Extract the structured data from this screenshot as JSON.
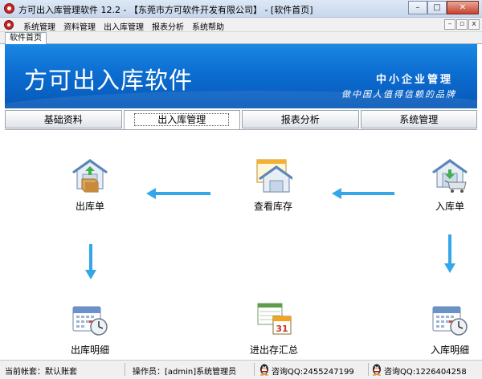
{
  "window": {
    "title": "方可出入库管理软件 12.2 - 【东莞市方可软件开发有限公司】 - [软件首页]",
    "buttons": {
      "minimize": "–",
      "maximize": "□",
      "close": "✕"
    }
  },
  "menu": {
    "items": [
      "系统管理",
      "资料管理",
      "出入库管理",
      "报表分析",
      "系统帮助"
    ],
    "mdi_buttons": {
      "minimize": "–",
      "restore": "▫",
      "close": "x"
    }
  },
  "doc_tab": {
    "label": "软件首页"
  },
  "banner": {
    "title": "方可出入库软件",
    "slogan_line1": "中小企业管理",
    "slogan_line2": "做中国人值得信赖的品牌"
  },
  "module_tabs": [
    {
      "label": "基础资料",
      "active": false
    },
    {
      "label": "出入库管理",
      "active": true
    },
    {
      "label": "报表分析",
      "active": false
    },
    {
      "label": "系统管理",
      "active": false
    }
  ],
  "workflow": {
    "outbound": {
      "label": "出库单",
      "icon": "warehouse-box-out-icon"
    },
    "stock": {
      "label": "查看库存",
      "icon": "warehouse-window-icon"
    },
    "inbound": {
      "label": "入库单",
      "icon": "warehouse-cart-in-icon"
    },
    "outbound_detail": {
      "label": "出库明细",
      "icon": "calendar-clock-icon"
    },
    "summary": {
      "label": "进出存汇总",
      "icon": "calendar-31-icon",
      "calendar_day": "31"
    },
    "inbound_detail": {
      "label": "入库明细",
      "icon": "calendar-clock-icon"
    }
  },
  "status": {
    "account": "当前帐套：默认账套",
    "operator": "操作员：[admin]系统管理员",
    "qq1": "咨询QQ:2455247199",
    "qq2": "咨询QQ:1226404258"
  },
  "colors": {
    "banner_top": "#1b88e2",
    "banner_bottom": "#0758b7",
    "arrow": "#35a7e9",
    "logo_red": "#c62828"
  }
}
